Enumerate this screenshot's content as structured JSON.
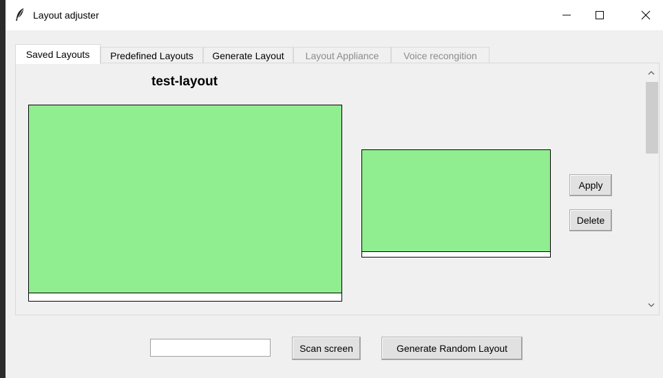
{
  "window": {
    "title": "Layout adjuster"
  },
  "tabs": [
    {
      "label": "Saved Layouts",
      "state": "active"
    },
    {
      "label": "Predefined Layouts",
      "state": "normal"
    },
    {
      "label": "Generate Layout",
      "state": "normal"
    },
    {
      "label": "Layout Appliance",
      "state": "disabled"
    },
    {
      "label": "Voice recongition",
      "state": "disabled"
    }
  ],
  "saved_layout": {
    "name": "test-layout",
    "apply_label": "Apply",
    "delete_label": "Delete"
  },
  "footer": {
    "input_value": "",
    "scan_label": "Scan screen",
    "generate_label": "Generate Random Layout"
  },
  "colors": {
    "monitor_fill": "#90ee90",
    "monitor_background": "#ffffff",
    "titlebar": "#ffffff",
    "window_background": "#f0f0f0"
  },
  "icons": {
    "app": "feather-icon",
    "minimize": "minimize-icon",
    "maximize": "maximize-icon",
    "close": "close-icon",
    "scroll_up": "chevron-up-icon",
    "scroll_down": "chevron-down-icon"
  }
}
